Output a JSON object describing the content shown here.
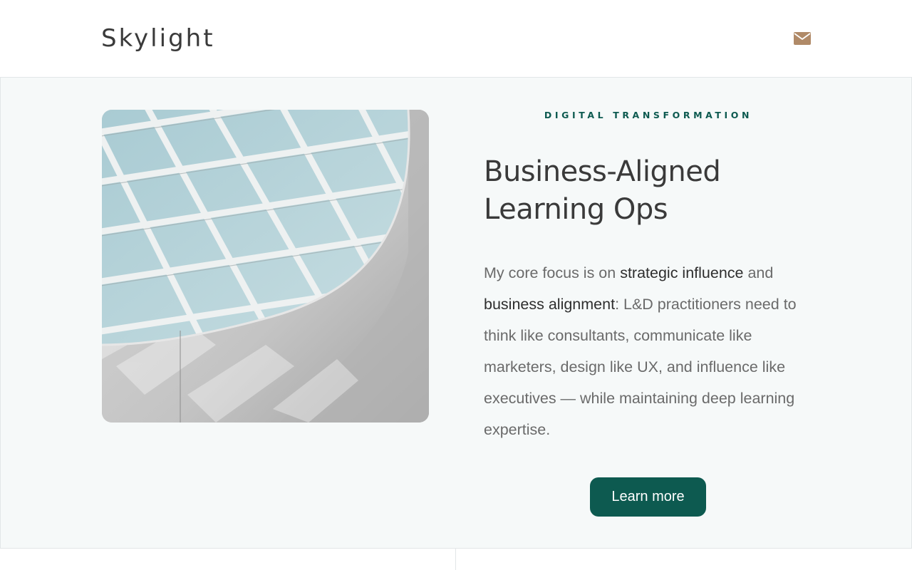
{
  "header": {
    "logo": "Skylight",
    "mail_icon": "envelope-icon",
    "accent_color": "#b08a68"
  },
  "hero": {
    "image_alt": "Architectural glass skylight ceiling",
    "eyebrow": "DIGITAL TRANSFORMATION",
    "headline_line1": "Business-Aligned",
    "headline_line2": "Learning Ops",
    "body": {
      "part1": "My core focus is on ",
      "strong1": "strategic influence",
      "part2": " and ",
      "strong2": "business alignment",
      "part3": ": L&D practitioners need to think like consultants, communicate like marketers, design like UX, and influence like executives — while maintaining deep learning expertise."
    },
    "cta_label": "Learn more",
    "brand_color": "#0d5a50"
  }
}
